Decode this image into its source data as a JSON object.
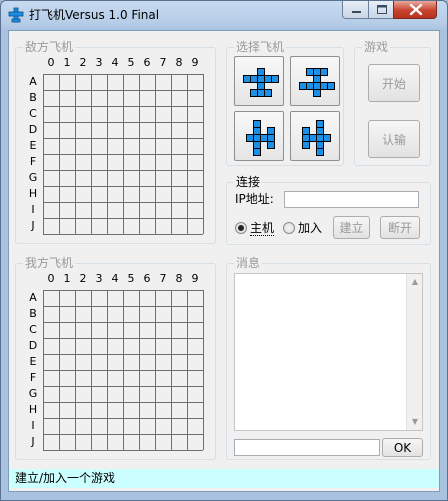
{
  "window": {
    "title": "打飞机Versus 1.0 Final",
    "colors": {
      "plane_fill": "#1c8fe6",
      "plane_outline": "#000000",
      "status_bg": "#ccffff",
      "close_red": "#c9442f"
    }
  },
  "grid": {
    "columns": [
      "0",
      "1",
      "2",
      "3",
      "4",
      "5",
      "6",
      "7",
      "8",
      "9"
    ],
    "rows": [
      "A",
      "B",
      "C",
      "D",
      "E",
      "F",
      "G",
      "H",
      "I",
      "J"
    ]
  },
  "enemy_board": {
    "title": "敌方飞机"
  },
  "my_board": {
    "title": "我方飞机"
  },
  "plane_select": {
    "title": "选择飞机",
    "options": [
      "plane-up-icon",
      "plane-down-icon",
      "plane-left-icon",
      "plane-right-icon"
    ]
  },
  "game": {
    "title": "游戏",
    "start_label": "开始",
    "surrender_label": "认输"
  },
  "connection": {
    "title": "连接",
    "ip_label": "IP地址:",
    "ip_value": "",
    "host_label": "主机",
    "join_label": "加入",
    "selected_mode": "主机",
    "build_label": "建立",
    "disconnect_label": "断开"
  },
  "messages": {
    "title": "消息",
    "input_value": "",
    "ok_label": "OK"
  },
  "status": {
    "text": "建立/加入一个游戏"
  }
}
